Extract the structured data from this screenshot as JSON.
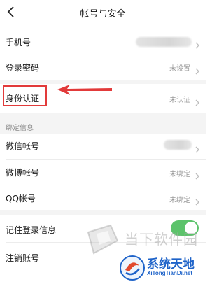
{
  "header": {
    "title": "帐号与安全"
  },
  "account": {
    "phone_label": "手机号",
    "password_label": "登录密码",
    "password_status": "未设置",
    "identity_label": "身份认证",
    "identity_status": "未认证"
  },
  "binding": {
    "section_title": "绑定信息",
    "wechat_label": "微信帐号",
    "weibo_label": "微博帐号",
    "weibo_status": "未绑定",
    "qq_label": "QQ帐号",
    "qq_status": "未绑定"
  },
  "settings": {
    "remember_label": "记住登录信息",
    "remember_on": true,
    "deactivate_label": "注销账号"
  },
  "watermarks": {
    "site1": "当下软件园",
    "site2_name": "系统天地",
    "site2_url": "XiTongTianDi.net"
  },
  "colors": {
    "annotation": "#e23a3a",
    "toggle_on": "#5cc36b",
    "watermark_blue": "#1e63c9"
  }
}
